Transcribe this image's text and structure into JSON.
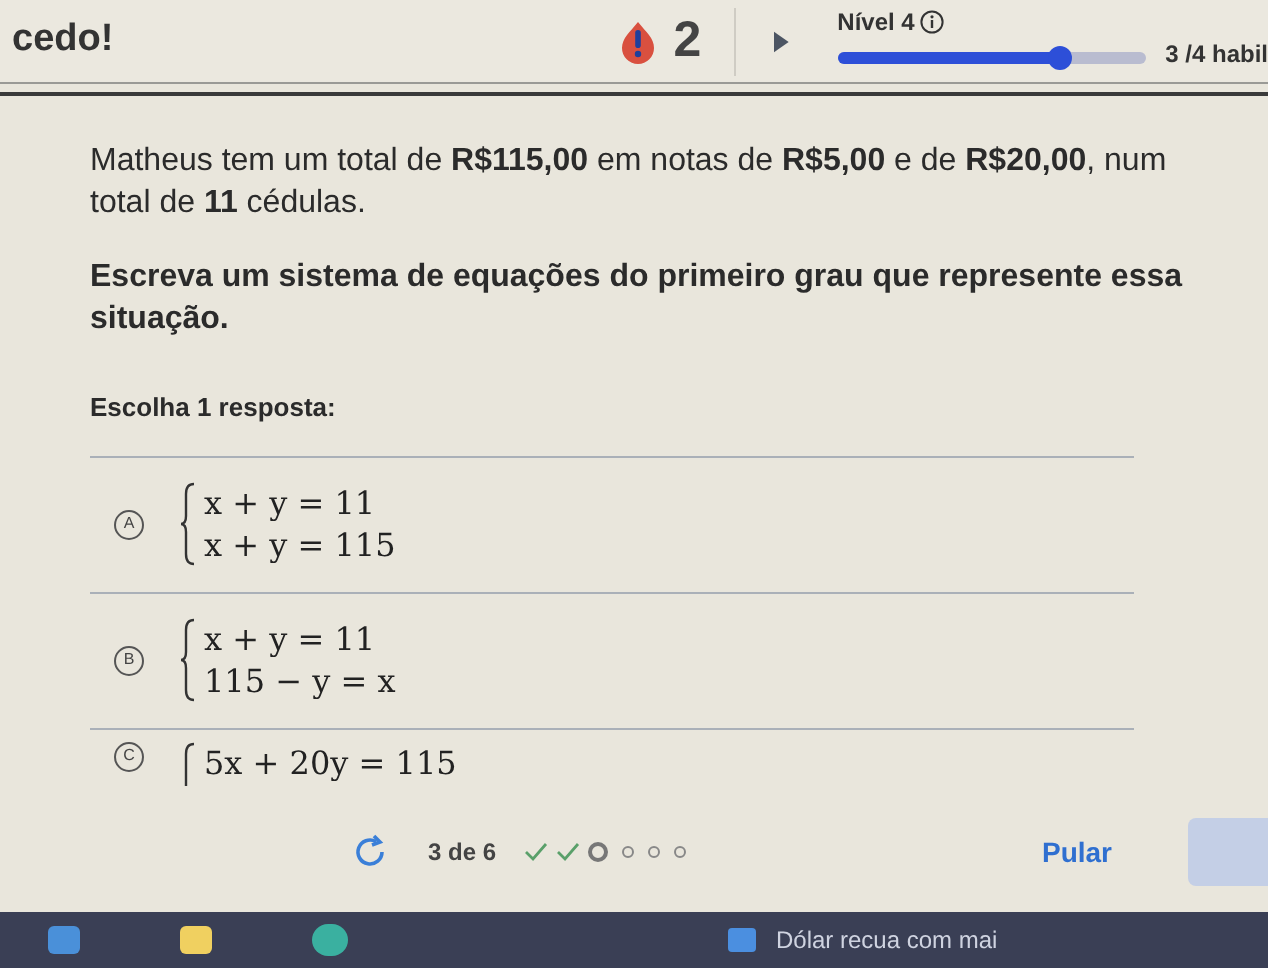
{
  "header": {
    "message": "cedo!",
    "streak_count": "2",
    "level_label": "Nível 4",
    "skills_progress": {
      "level": 0.72
    },
    "skills_text": "3 /4 habil"
  },
  "question": {
    "paragraphs": [
      "Matheus tem um total de **R$115,00** em notas de **R$5,00** e de **R$20,00**, num total de **11** cédulas.",
      "Escreva um sistema de equações do primeiro grau que represente essa situação."
    ],
    "instruction": "Escolha 1 resposta:",
    "options": [
      {
        "letter": "A",
        "selected": false,
        "equations": [
          "x + y = 11",
          "x + y = 115"
        ]
      },
      {
        "letter": "B",
        "selected": false,
        "equations": [
          "x + y = 11",
          "115 − y = x"
        ]
      },
      {
        "letter": "C",
        "selected": false,
        "equations": [
          "5x + 20y = 115"
        ]
      }
    ]
  },
  "footer": {
    "counter": "3 de 6",
    "steps": [
      {
        "kind": "done"
      },
      {
        "kind": "done"
      },
      {
        "kind": "current"
      },
      {
        "kind": "pending"
      },
      {
        "kind": "pending"
      },
      {
        "kind": "pending"
      }
    ],
    "skip_label": "Pular"
  },
  "taskbar": {
    "news": "Dólar recua com mai"
  }
}
